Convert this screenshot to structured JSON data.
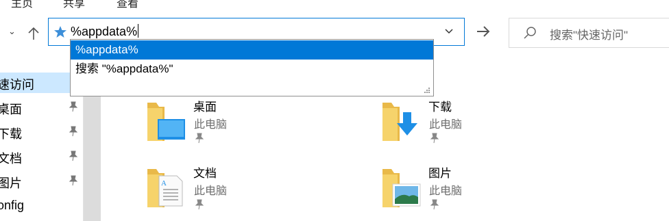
{
  "ribbon": {
    "tabs": [
      "主页",
      "共享",
      "查看"
    ]
  },
  "address": {
    "value": "%appdata%"
  },
  "search": {
    "placeholder": "搜索\"快速访问\""
  },
  "autocomplete": {
    "items": [
      "%appdata%",
      "搜索 \"%appdata%\""
    ]
  },
  "nav": {
    "items": [
      "速访问",
      "桌面",
      "下载",
      "文档",
      "图片",
      "onfig"
    ]
  },
  "tiles": [
    {
      "name": "桌面",
      "location": "此电脑"
    },
    {
      "name": "下载",
      "location": "此电脑"
    },
    {
      "name": "文档",
      "location": "此电脑"
    },
    {
      "name": "图片",
      "location": "此电脑"
    }
  ],
  "colors": {
    "accent": "#0078d7",
    "selection": "#cce8ff",
    "folder": "#f6d36b"
  }
}
